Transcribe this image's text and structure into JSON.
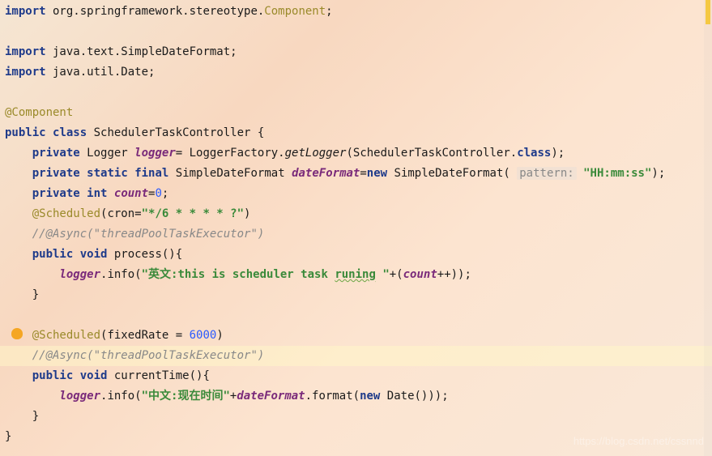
{
  "code": {
    "l1": {
      "kw": "import",
      "pkg": " org.springframework.stereotype.",
      "cls": "Component",
      "semi": ";"
    },
    "l3": {
      "kw": "import",
      "pkg": " java.text.SimpleDateFormat;",
      "semi": ""
    },
    "l4": {
      "kw": "import",
      "pkg": " java.util.Date;",
      "semi": ""
    },
    "l6": {
      "anno": "@Component"
    },
    "l7": {
      "kw1": "public",
      "kw2": "class",
      "name": " SchedulerTaskController {"
    },
    "l8": {
      "indent": "    ",
      "kw1": "private",
      "type": " Logger ",
      "field": "logger",
      "eq": "= LoggerFactory.",
      "method": "getLogger",
      "args": "(SchedulerTaskController.",
      "kw2": "class",
      "close": ");"
    },
    "l9": {
      "indent": "    ",
      "kw1": "private",
      "kw2": "static",
      "kw3": "final",
      "type": " SimpleDateFormat ",
      "field": "dateFormat",
      "eq": "=",
      "kw4": "new",
      "ctor": " SimpleDateFormat( ",
      "hint": "pattern:",
      "str": "\"HH:mm:ss\"",
      "close": ");"
    },
    "l10": {
      "indent": "    ",
      "kw1": "private",
      "kw2": "int",
      "field": " count",
      "eq": "=",
      "num": "0",
      "semi": ";"
    },
    "l11": {
      "indent": "    ",
      "anno": "@Scheduled",
      "open": "(cron=",
      "str": "\"*/6 * * * * ?\"",
      "close": ")"
    },
    "l12": {
      "indent": "    ",
      "comment": "//@Async(\"threadPoolTaskExecutor\")"
    },
    "l13": {
      "indent": "    ",
      "kw1": "public",
      "kw2": "void",
      "name": " process(){"
    },
    "l14": {
      "indent": "        ",
      "field": "logger",
      "call": ".info(",
      "str1": "\"英文:this is scheduler task ",
      "wavy": "runing",
      "str2": " \"",
      "plus": "+(",
      "field2": "count",
      "inc": "++));"
    },
    "l15": {
      "indent": "    ",
      "brace": "}"
    },
    "l17": {
      "indent": "    ",
      "anno": "@Scheduled",
      "open": "(fixedRate = ",
      "num": "6000",
      "close": ")"
    },
    "l18": {
      "indent": "    ",
      "comment": "//@Async(\"threadPoolTaskExecutor\")"
    },
    "l19": {
      "indent": "    ",
      "kw1": "public",
      "kw2": "void",
      "name": " currentTime(){"
    },
    "l20": {
      "indent": "        ",
      "field": "logger",
      "call": ".info(",
      "str": "\"中文:现在时间\"",
      "plus": "+",
      "field2": "dateFormat",
      "fmt": ".format(",
      "kw": "new",
      "date": " Date()));"
    },
    "l21": {
      "indent": "    ",
      "brace": "}"
    },
    "l22": {
      "brace": "}"
    }
  },
  "watermark": "https://blog.csdn.net/cssnnd"
}
